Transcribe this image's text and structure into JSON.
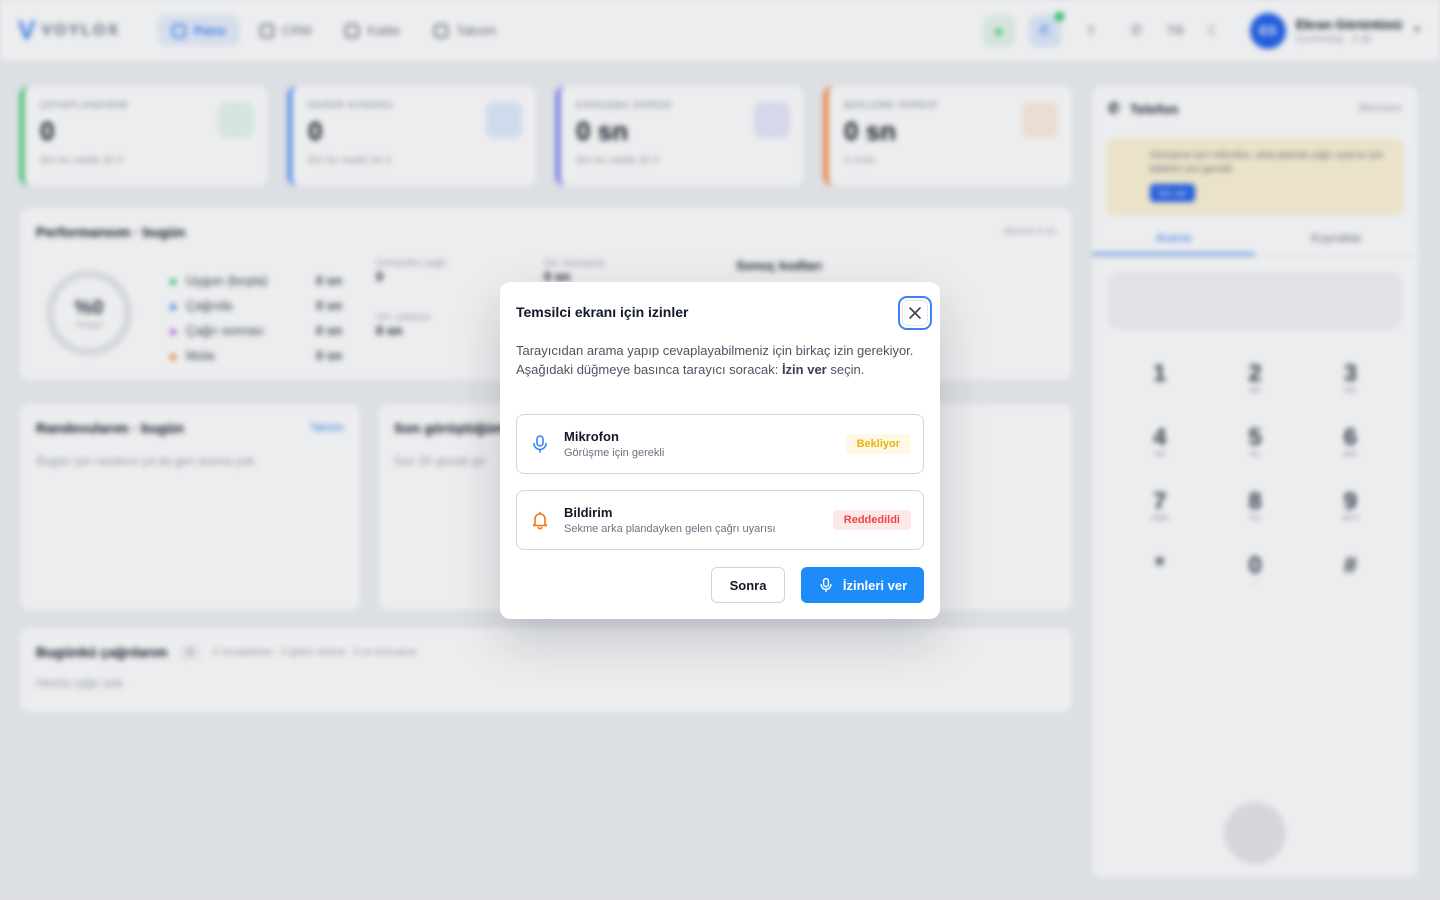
{
  "app": {
    "logo_text": "VOYLOX",
    "nav": [
      {
        "label": "Pano",
        "active": true
      },
      {
        "label": "CRM",
        "active": false
      },
      {
        "label": "Kalite",
        "active": false
      },
      {
        "label": "Takvim",
        "active": false
      }
    ],
    "lang": "TR",
    "user": {
      "initials": "ES",
      "name": "Ekran Görüntüsü",
      "status": "Çevrimdışı · 0 dk"
    },
    "stats": [
      {
        "label": "ÇEVAPLANDIĞIM",
        "value": "0",
        "sub": "dün bu saatte de 0",
        "color": "#22c55e"
      },
      {
        "label": "DEĞER KONUSU",
        "value": "0",
        "sub": "dün bu saatte de 0",
        "color": "#3b82f6"
      },
      {
        "label": "KONUŞMA SÜRESİ",
        "value": "0 sn",
        "sub": "dün bu saatte de 0",
        "color": "#6366f1"
      },
      {
        "label": "BEKLEME SÜRESİ",
        "value": "0 sn",
        "sub": "0 mola",
        "color": "#f97316"
      }
    ],
    "performance": {
      "title": "Performansım · bugün",
      "meta": "oturum 0 sn",
      "donut_value": "%0",
      "donut_label": "meşgul",
      "legend": [
        {
          "label": "Uygun (boşta)",
          "value": "0 sn",
          "color": "#22c55e"
        },
        {
          "label": "Çağrıda",
          "value": "0 sn",
          "color": "#3b82f6"
        },
        {
          "label": "Çağrı sonrası",
          "value": "0 sn",
          "color": "#a855f7"
        },
        {
          "label": "Mola",
          "value": "0 sn",
          "color": "#f97316"
        }
      ],
      "metrics": [
        {
          "label": "Görüşülen çağrı",
          "value": "0"
        },
        {
          "label": "Ort. konuşma",
          "value": "0 sn"
        },
        {
          "label": "Ort. çalışma",
          "value": "0 sn"
        }
      ],
      "result_codes_title": "Sonuç kodları"
    },
    "appointments": {
      "title": "Randevularım · bugün",
      "link": "Takvim",
      "empty": "Bugün için randevu ya da geri arama yok."
    },
    "recent": {
      "title": "Son görüştüğüm",
      "empty": "Son 30 günde gö"
    },
    "calls_today": {
      "title": "Bugünkü çağrılarım",
      "count": "0",
      "meta": "0 cevaplanan · 0 giden arama · 0 sn konuşma",
      "empty": "Henüz çağrı yok."
    },
    "phone": {
      "title": "Telefon",
      "status": "Bilinmiyor",
      "warning": "Görüşme için mikrofon, arka planda çağrı uyarısı için bildirim izni gerekli.",
      "warning_button": "İzin ver",
      "tabs": [
        "Arama",
        "Kuyruklar"
      ],
      "keys": [
        {
          "digit": "1",
          "letters": ""
        },
        {
          "digit": "2",
          "letters": "ABC"
        },
        {
          "digit": "3",
          "letters": "DEF"
        },
        {
          "digit": "4",
          "letters": "GHI"
        },
        {
          "digit": "5",
          "letters": "JKL"
        },
        {
          "digit": "6",
          "letters": "MNO"
        },
        {
          "digit": "7",
          "letters": "PQRS"
        },
        {
          "digit": "8",
          "letters": "TUV"
        },
        {
          "digit": "9",
          "letters": "WXYZ"
        },
        {
          "digit": "*",
          "letters": ""
        },
        {
          "digit": "0",
          "letters": "+"
        },
        {
          "digit": "#",
          "letters": ""
        }
      ]
    }
  },
  "modal": {
    "title": "Temsilci ekranı için izinler",
    "desc_text": "Tarayıcıdan arama yapıp cevaplayabilmeniz için birkaç izin gerekiyor. Aşağıdaki düğmeye basınca tarayıcı soracak:",
    "desc_bold": "İzin ver",
    "desc_end": "seçin.",
    "permissions": [
      {
        "name": "Mikrofon",
        "sub": "Görüşme için gerekli",
        "badge": "Bekliyor",
        "icon": "microphone-icon",
        "icon_color": "#3b82f6",
        "badge_color": "#eab308"
      },
      {
        "name": "Bildirim",
        "sub": "Sekme arka plandayken gelen çağrı uyarısı",
        "badge": "Reddedildi",
        "icon": "bell-icon",
        "icon_color": "#f97316",
        "badge_color": "#ef4444"
      }
    ],
    "later_label": "Sonra",
    "grant_label": "İzinleri ver"
  }
}
